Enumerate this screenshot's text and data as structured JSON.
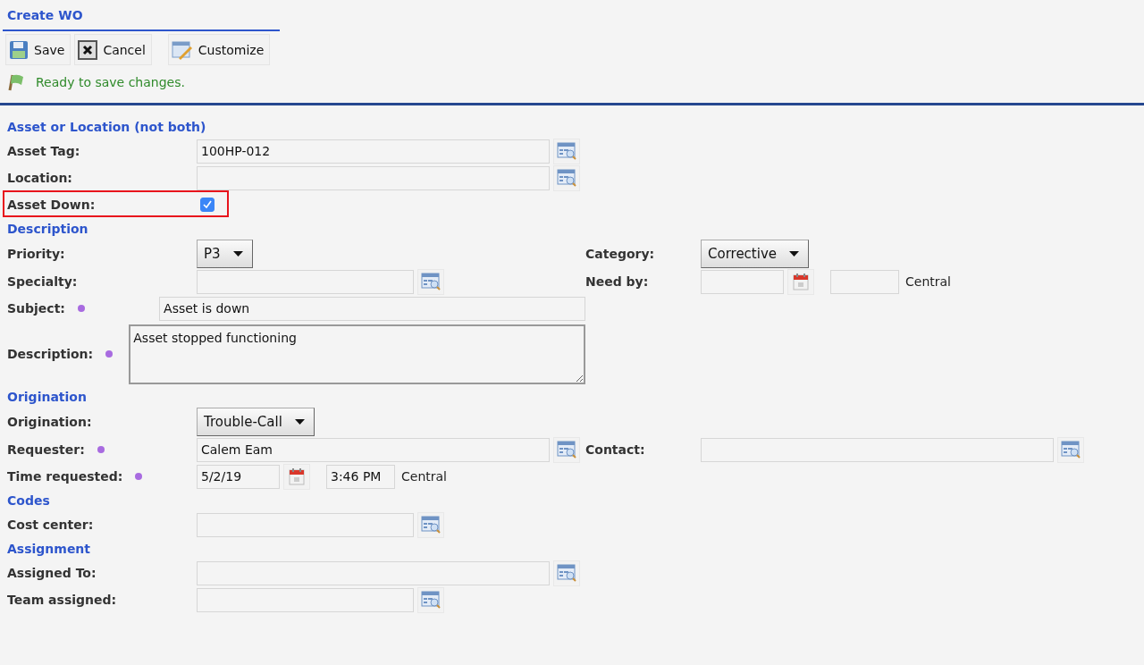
{
  "title": "Create WO",
  "toolbar": [
    {
      "label": "Save",
      "kind": "save"
    },
    {
      "label": "Cancel",
      "kind": "cancel"
    },
    {
      "label": "Customize",
      "kind": "customize"
    }
  ],
  "status": "Ready to save changes.",
  "sections": [
    {
      "title": "Asset or Location (not both)",
      "rows": [
        {
          "label": "Asset Tag:",
          "required": false,
          "field": {
            "kind": "lookup",
            "value": "100HP-012"
          }
        },
        {
          "label": "Location:",
          "required": false,
          "field": {
            "kind": "lookup"
          }
        },
        {
          "label": "Asset Down:",
          "required": false,
          "highlighted": true,
          "field": {
            "kind": "checkbox",
            "checked": true
          }
        }
      ]
    },
    {
      "title": "Description",
      "rows": [
        {
          "label": "Priority:",
          "required": false,
          "field": {
            "kind": "select",
            "value": "P3"
          },
          "right": {
            "label": "Category:",
            "required": false,
            "field": {
              "kind": "select",
              "value": "Corrective"
            }
          }
        },
        {
          "label": "Specialty:",
          "required": false,
          "field": {
            "kind": "short-lookup"
          },
          "right": {
            "label": "Need by:",
            "required": false,
            "field": {
              "kind": "datetime",
              "zone": "Central"
            }
          }
        },
        {
          "label": "Subject:",
          "required": true,
          "field": {
            "kind": "text",
            "value": "Asset is down"
          }
        },
        {
          "label": "Description:",
          "required": true,
          "field": {
            "kind": "textarea",
            "value": "Asset stopped functioning"
          }
        }
      ]
    },
    {
      "title": "Origination",
      "rows": [
        {
          "label": "Origination:",
          "required": false,
          "field": {
            "kind": "select",
            "value": "Trouble-Call"
          }
        },
        {
          "label": "Requester:",
          "required": true,
          "field": {
            "kind": "lookup",
            "value": "Calem Eam"
          },
          "right": {
            "label": "Contact:",
            "required": false,
            "field": {
              "kind": "lookup"
            }
          }
        },
        {
          "label": "Time requested:",
          "required": true,
          "field": {
            "kind": "datetime",
            "date": "5/2/19",
            "time": "3:46 PM",
            "zone": "Central"
          }
        }
      ]
    },
    {
      "title": "Codes",
      "rows": [
        {
          "label": "Cost center:",
          "required": false,
          "field": {
            "kind": "short-lookup"
          }
        }
      ]
    },
    {
      "title": "Assignment",
      "rows": [
        {
          "label": "Assigned To:",
          "required": false,
          "field": {
            "kind": "lookup"
          }
        },
        {
          "label": "Team assigned:",
          "required": false,
          "field": {
            "kind": "short-lookup"
          }
        }
      ]
    }
  ]
}
